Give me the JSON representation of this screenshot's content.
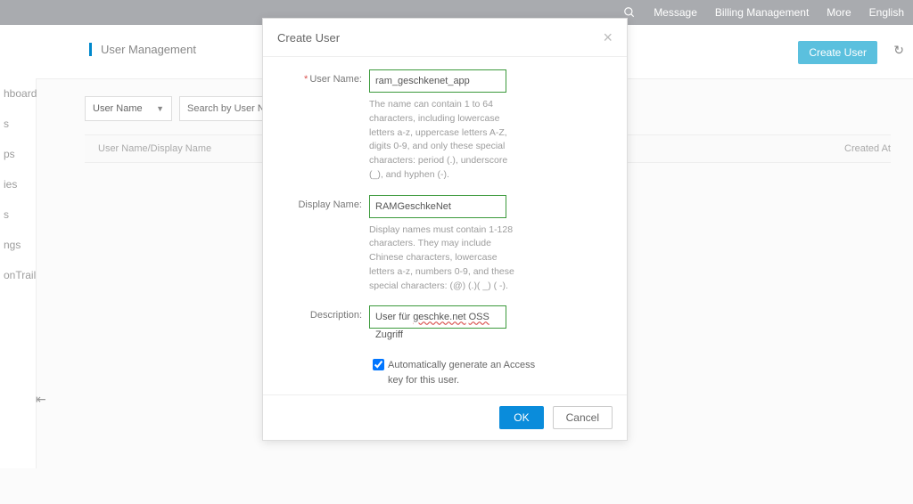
{
  "topnav": {
    "search_icon": "search",
    "items": [
      "Message",
      "Billing Management",
      "More",
      "English"
    ]
  },
  "page": {
    "title": "User Management",
    "create_btn": "Create User",
    "refresh_icon": "↻"
  },
  "sidebar": {
    "items": [
      "hboard",
      "s",
      "ps",
      "ies",
      "s",
      "ngs",
      "onTrail"
    ]
  },
  "filter": {
    "select_label": "User Name",
    "search_placeholder": "Search by User Name"
  },
  "table": {
    "col1": "User Name/Display Name",
    "col2": "Created At"
  },
  "modal": {
    "title": "Create User",
    "fields": {
      "username_label": "User Name:",
      "username_value": "ram_geschkenet_app",
      "username_hint": "The name can contain 1 to 64 characters, including lowercase letters a-z, uppercase letters A-Z, digits 0-9, and only these special characters: period (.), underscore (_), and hyphen (-).",
      "display_label": "Display Name:",
      "display_value": "RAMGeschkeNet",
      "display_hint": "Display names must contain 1-128 characters. They may include Chinese characters, lowercase letters a-z, numbers 0-9, and these special characters: (@) (.)( _) ( -).",
      "desc_label": "Description:",
      "desc_value_pre": "User für ",
      "desc_value_mark1": "geschke.net",
      "desc_value_mid": " ",
      "desc_value_mark2": "OSS",
      "desc_value_post": " Zugriff",
      "checkbox_label": "Automatically generate an Access key for this user."
    },
    "ok": "OK",
    "cancel": "Cancel"
  }
}
